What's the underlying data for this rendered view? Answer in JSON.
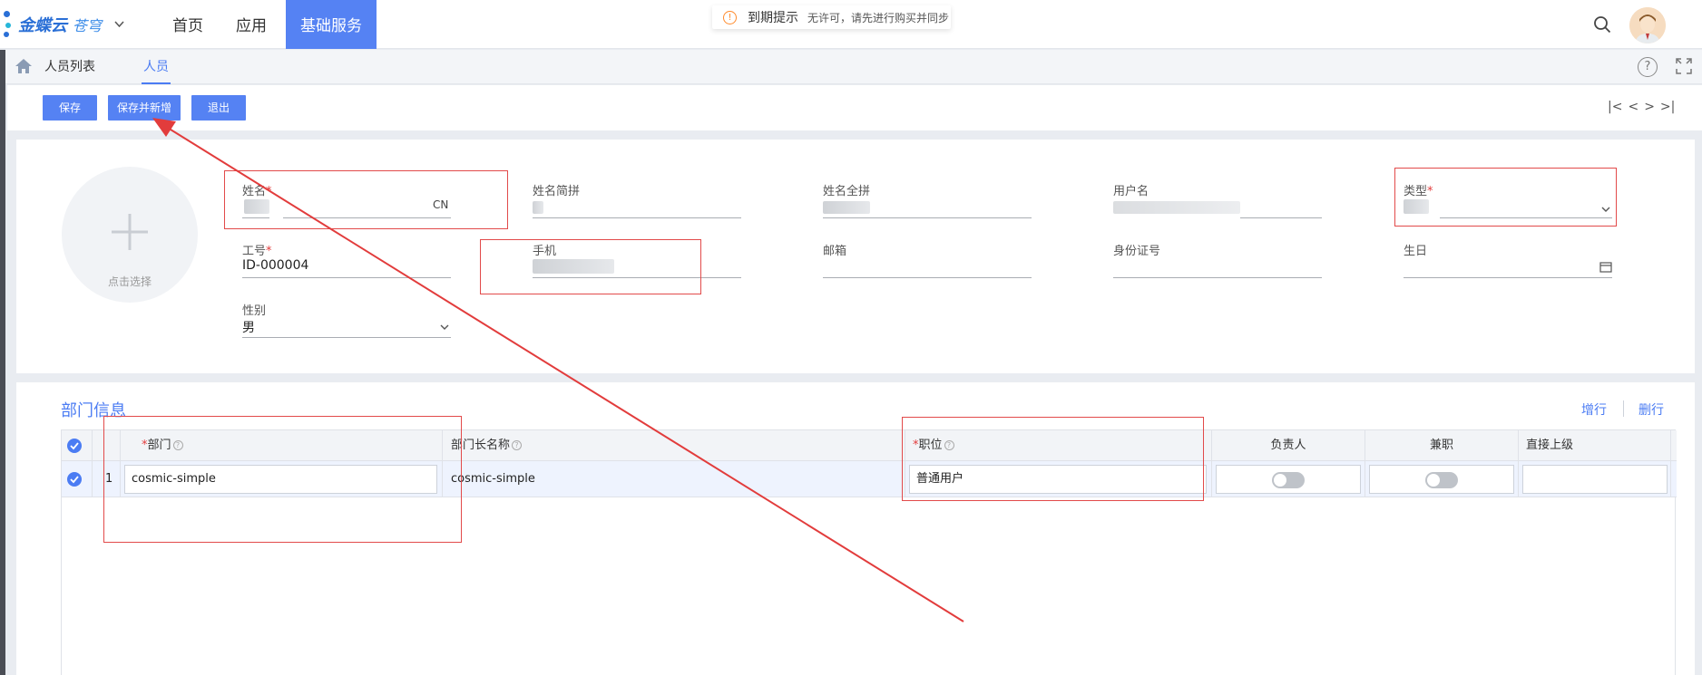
{
  "logo": {
    "brand": "金蝶云",
    "product": "苍穹"
  },
  "nav": [
    {
      "label": "首页"
    },
    {
      "label": "应用"
    },
    {
      "label": "基础服务"
    }
  ],
  "notice": {
    "title": "到期提示",
    "message": "无许可，请先进行购买并同步"
  },
  "breadcrumb": [
    {
      "label": "人员列表"
    },
    {
      "label": "人员"
    }
  ],
  "toolbar": {
    "save": "保存",
    "save_new": "保存并新增",
    "exit": "退出"
  },
  "pager": {
    "first": "|<",
    "prev": "<",
    "next": ">",
    "last": ">|"
  },
  "photo": {
    "label": "点击选择"
  },
  "form": {
    "name": {
      "label": "姓名",
      "suffix": "CN"
    },
    "name_abbr": {
      "label": "姓名简拼"
    },
    "name_full": {
      "label": "姓名全拼"
    },
    "username": {
      "label": "用户名"
    },
    "type": {
      "label": "类型"
    },
    "job_no": {
      "label": "工号",
      "value": "ID-000004"
    },
    "mobile": {
      "label": "手机"
    },
    "email": {
      "label": "邮箱"
    },
    "id_card": {
      "label": "身份证号"
    },
    "birthday": {
      "label": "生日"
    },
    "gender": {
      "label": "性别",
      "value": "男"
    }
  },
  "dept": {
    "title": "部门信息",
    "add_row": "增行",
    "del_row": "删行",
    "columns": {
      "dept": "部门",
      "dept_long": "部门长名称",
      "position": "职位",
      "manager": "负责人",
      "part_time": "兼职",
      "superior": "直接上级"
    },
    "rows": [
      {
        "index": "1",
        "dept": "cosmic-simple",
        "dept_long": "cosmic-simple",
        "position": "普通用户",
        "superior": ""
      }
    ]
  },
  "colors": {
    "accent": "#5582f3",
    "annotation": "#e24a4a"
  }
}
